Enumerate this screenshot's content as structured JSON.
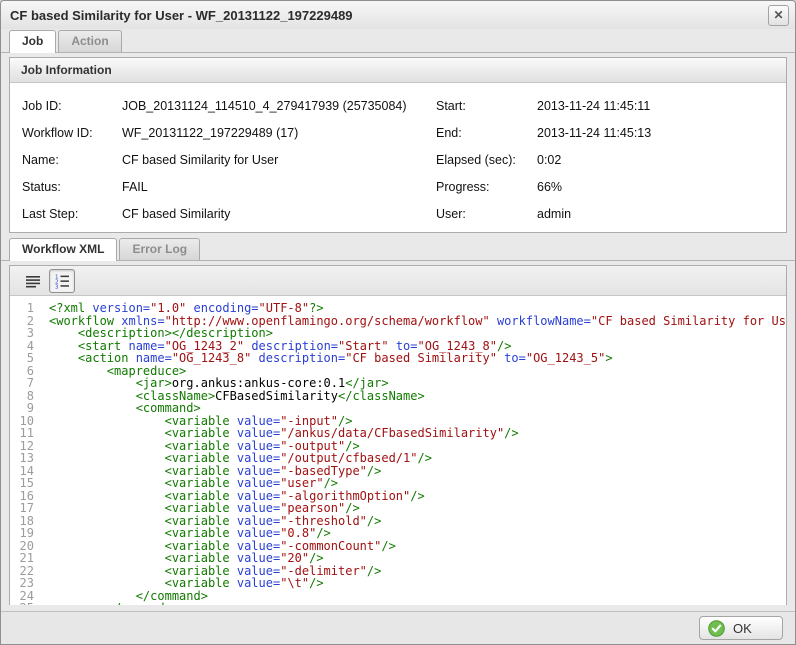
{
  "window": {
    "title": "CF based Similarity for User - WF_20131122_197229489",
    "close_glyph": "✕"
  },
  "top_tabs": [
    {
      "label": "Job",
      "active": true
    },
    {
      "label": "Action",
      "active": false
    }
  ],
  "job_info": {
    "header": "Job Information",
    "left_fields": [
      {
        "label": "Job ID:",
        "value": "JOB_20131124_114510_4_279417939 (25735084)"
      },
      {
        "label": "Workflow ID:",
        "value": "WF_20131122_197229489 (17)"
      },
      {
        "label": "Name:",
        "value": "CF based Similarity for User"
      },
      {
        "label": "Status:",
        "value": "FAIL"
      },
      {
        "label": "Last Step:",
        "value": "CF based Similarity"
      }
    ],
    "right_fields": [
      {
        "label": "Start:",
        "value": "2013-11-24 11:45:11"
      },
      {
        "label": "End:",
        "value": "2013-11-24 11:45:13"
      },
      {
        "label": "Elapsed (sec):",
        "value": "0:02"
      },
      {
        "label": "Progress:",
        "value": "66%"
      },
      {
        "label": "User:",
        "value": "admin"
      }
    ]
  },
  "bottom_tabs": [
    {
      "label": "Workflow XML",
      "active": true
    },
    {
      "label": "Error Log",
      "active": false
    }
  ],
  "editor": {
    "toolbar_icons": [
      "word-wrap",
      "line-numbers"
    ],
    "syntax_colors": {
      "tag": "#117a00",
      "attr": "#2a3fd4",
      "string": "#a11111",
      "text": "#000000",
      "line_number": "#9c9c9c"
    },
    "lines": [
      {
        "n": 1,
        "segments": [
          [
            "t",
            "<?xml "
          ],
          [
            "a",
            "version="
          ],
          [
            "s",
            "\"1.0\""
          ],
          [
            "a",
            " encoding="
          ],
          [
            "s",
            "\"UTF-8\""
          ],
          [
            "t",
            "?>"
          ]
        ]
      },
      {
        "n": 2,
        "segments": [
          [
            "t",
            "<workflow "
          ],
          [
            "a",
            "xmlns="
          ],
          [
            "s",
            "\"http://www.openflamingo.org/schema/workflow\""
          ],
          [
            "a",
            " workflowName="
          ],
          [
            "s",
            "\"CF based Similarity for User"
          ]
        ]
      },
      {
        "n": 3,
        "segments": [
          [
            "t",
            "    <description></description>"
          ]
        ]
      },
      {
        "n": 4,
        "segments": [
          [
            "t",
            "    <start "
          ],
          [
            "a",
            "name="
          ],
          [
            "s",
            "\"OG_1243_2\""
          ],
          [
            "a",
            " description="
          ],
          [
            "s",
            "\"Start\""
          ],
          [
            "a",
            " to="
          ],
          [
            "s",
            "\"OG_1243_8\""
          ],
          [
            "t",
            "/>"
          ]
        ]
      },
      {
        "n": 5,
        "segments": [
          [
            "t",
            "    <action "
          ],
          [
            "a",
            "name="
          ],
          [
            "s",
            "\"OG_1243_8\""
          ],
          [
            "a",
            " description="
          ],
          [
            "s",
            "\"CF based Similarity\""
          ],
          [
            "a",
            " to="
          ],
          [
            "s",
            "\"OG_1243_5\""
          ],
          [
            "t",
            ">"
          ]
        ]
      },
      {
        "n": 6,
        "segments": [
          [
            "t",
            "        <mapreduce>"
          ]
        ]
      },
      {
        "n": 7,
        "segments": [
          [
            "t",
            "            <jar>"
          ],
          [
            "p",
            "org.ankus:ankus-core:0.1"
          ],
          [
            "t",
            "</jar>"
          ]
        ]
      },
      {
        "n": 8,
        "segments": [
          [
            "t",
            "            <className>"
          ],
          [
            "p",
            "CFBasedSimilarity"
          ],
          [
            "t",
            "</className>"
          ]
        ]
      },
      {
        "n": 9,
        "segments": [
          [
            "t",
            "            <command>"
          ]
        ]
      },
      {
        "n": 10,
        "segments": [
          [
            "t",
            "                <variable "
          ],
          [
            "a",
            "value="
          ],
          [
            "s",
            "\"-input\""
          ],
          [
            "t",
            "/>"
          ]
        ]
      },
      {
        "n": 11,
        "segments": [
          [
            "t",
            "                <variable "
          ],
          [
            "a",
            "value="
          ],
          [
            "s",
            "\"/ankus/data/CFbasedSimilarity\""
          ],
          [
            "t",
            "/>"
          ]
        ]
      },
      {
        "n": 12,
        "segments": [
          [
            "t",
            "                <variable "
          ],
          [
            "a",
            "value="
          ],
          [
            "s",
            "\"-output\""
          ],
          [
            "t",
            "/>"
          ]
        ]
      },
      {
        "n": 13,
        "segments": [
          [
            "t",
            "                <variable "
          ],
          [
            "a",
            "value="
          ],
          [
            "s",
            "\"/output/cfbased/1\""
          ],
          [
            "t",
            "/>"
          ]
        ]
      },
      {
        "n": 14,
        "segments": [
          [
            "t",
            "                <variable "
          ],
          [
            "a",
            "value="
          ],
          [
            "s",
            "\"-basedType\""
          ],
          [
            "t",
            "/>"
          ]
        ]
      },
      {
        "n": 15,
        "segments": [
          [
            "t",
            "                <variable "
          ],
          [
            "a",
            "value="
          ],
          [
            "s",
            "\"user\""
          ],
          [
            "t",
            "/>"
          ]
        ]
      },
      {
        "n": 16,
        "segments": [
          [
            "t",
            "                <variable "
          ],
          [
            "a",
            "value="
          ],
          [
            "s",
            "\"-algorithmOption\""
          ],
          [
            "t",
            "/>"
          ]
        ]
      },
      {
        "n": 17,
        "segments": [
          [
            "t",
            "                <variable "
          ],
          [
            "a",
            "value="
          ],
          [
            "s",
            "\"pearson\""
          ],
          [
            "t",
            "/>"
          ]
        ]
      },
      {
        "n": 18,
        "segments": [
          [
            "t",
            "                <variable "
          ],
          [
            "a",
            "value="
          ],
          [
            "s",
            "\"-threshold\""
          ],
          [
            "t",
            "/>"
          ]
        ]
      },
      {
        "n": 19,
        "segments": [
          [
            "t",
            "                <variable "
          ],
          [
            "a",
            "value="
          ],
          [
            "s",
            "\"0.8\""
          ],
          [
            "t",
            "/>"
          ]
        ]
      },
      {
        "n": 20,
        "segments": [
          [
            "t",
            "                <variable "
          ],
          [
            "a",
            "value="
          ],
          [
            "s",
            "\"-commonCount\""
          ],
          [
            "t",
            "/>"
          ]
        ]
      },
      {
        "n": 21,
        "segments": [
          [
            "t",
            "                <variable "
          ],
          [
            "a",
            "value="
          ],
          [
            "s",
            "\"20\""
          ],
          [
            "t",
            "/>"
          ]
        ]
      },
      {
        "n": 22,
        "segments": [
          [
            "t",
            "                <variable "
          ],
          [
            "a",
            "value="
          ],
          [
            "s",
            "\"-delimiter\""
          ],
          [
            "t",
            "/>"
          ]
        ]
      },
      {
        "n": 23,
        "segments": [
          [
            "t",
            "                <variable "
          ],
          [
            "a",
            "value="
          ],
          [
            "s",
            "\"\\t\""
          ],
          [
            "t",
            "/>"
          ]
        ]
      },
      {
        "n": 24,
        "segments": [
          [
            "t",
            "            </command>"
          ]
        ]
      },
      {
        "n": 25,
        "segments": [
          [
            "t",
            "        </mapreduce>"
          ]
        ]
      }
    ]
  },
  "footer": {
    "ok_label": "OK",
    "ok_icon_color": "#63b84f"
  }
}
